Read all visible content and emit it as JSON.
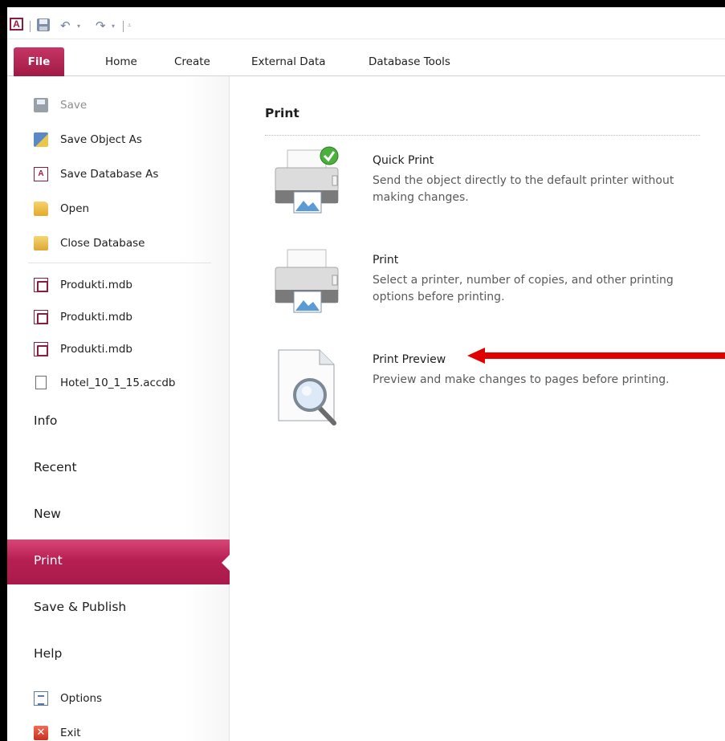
{
  "quick_access": {
    "app_logo_letter": "A",
    "save_icon": "save-icon",
    "undo_icon": "undo-icon",
    "redo_icon": "redo-icon",
    "customize_icon": "customize-toolbar-icon"
  },
  "ribbon_tabs": [
    {
      "label": "File"
    },
    {
      "label": "Home"
    },
    {
      "label": "Create"
    },
    {
      "label": "External Data"
    },
    {
      "label": "Database Tools"
    }
  ],
  "nav": {
    "save": "Save",
    "save_object_as": "Save Object As",
    "save_database_as": "Save Database As",
    "open": "Open",
    "close_database": "Close Database",
    "recent_files": [
      {
        "label": "Produkti.mdb"
      },
      {
        "label": "Produkti.mdb"
      },
      {
        "label": "Produkti.mdb"
      },
      {
        "label": "Hotel_10_1_15.accdb"
      }
    ],
    "info": "Info",
    "recent": "Recent",
    "new": "New",
    "print": "Print",
    "save_publish": "Save & Publish",
    "help": "Help",
    "options": "Options",
    "exit": "Exit"
  },
  "main": {
    "title": "Print",
    "options": [
      {
        "title": "Quick Print",
        "description": "Send the object directly to the default printer without making changes."
      },
      {
        "title": "Print",
        "description": "Select a printer, number of copies, and other printing options before printing."
      },
      {
        "title": "Print Preview",
        "description": "Preview and make changes to pages before printing."
      }
    ]
  },
  "colors": {
    "file_tab": "#b5214f",
    "selected_nav": "#b71f52",
    "annotation_arrow": "#e00000"
  }
}
